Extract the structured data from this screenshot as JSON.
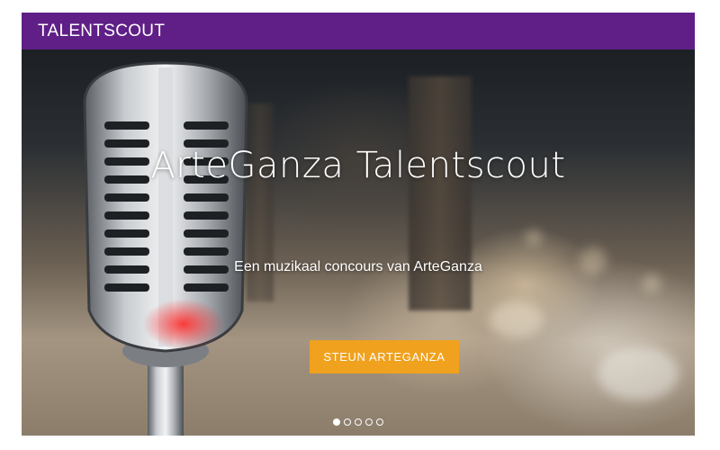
{
  "header": {
    "brand": "TALENTSCOUT",
    "background_color": "#5f1f87"
  },
  "hero": {
    "title": "ArteGanza Talentscout",
    "subtitle": "Een muzikaal concours van ArteGanza",
    "cta_label": "STEUN ARTEGANZA",
    "cta_color": "#f0a11e",
    "image_subject": "vintage-microphone-photo"
  },
  "carousel": {
    "slide_count": 5,
    "active_index": 0,
    "indicators": [
      "slide-1",
      "slide-2",
      "slide-3",
      "slide-4",
      "slide-5"
    ]
  }
}
